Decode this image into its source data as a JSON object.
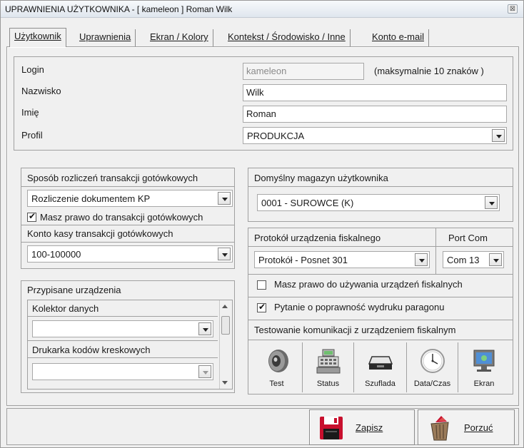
{
  "window": {
    "title": "UPRAWNIENIA UŻYTKOWNIKA - [ kameleon ] Roman Wilk",
    "close_glyph": "⊠"
  },
  "tabs": [
    {
      "label": "Użytkownik",
      "active": true
    },
    {
      "label": "Uprawnienia",
      "active": false
    },
    {
      "label": "Ekran / Kolory",
      "active": false
    },
    {
      "label": "Kontekst / Środowisko / Inne",
      "active": false
    },
    {
      "label": "Konto e-mail",
      "active": false
    }
  ],
  "user": {
    "login_label": "Login",
    "login_value": "kameleon",
    "login_hint": "(maksymalnie 10 znaków )",
    "surname_label": "Nazwisko",
    "surname_value": "Wilk",
    "name_label": "Imię",
    "name_value": "Roman",
    "profile_label": "Profil",
    "profile_value": "PRODUKCJA"
  },
  "cash": {
    "settlement_title": "Sposób rozliczeń transakcji gotówkowych",
    "settlement_value": "Rozliczenie dokumentem KP",
    "right_label": "Masz prawo do transakcji gotówkowych",
    "right_checked": true,
    "account_title": "Konto kasy transakcji gotówkowych",
    "account_value": "100-100000"
  },
  "devices": {
    "title": "Przypisane urządzenia",
    "collector_label": "Kolektor danych",
    "collector_value": "",
    "barcode_label": "Drukarka kodów kreskowych",
    "barcode_value": ""
  },
  "warehouse": {
    "title": "Domyślny magazyn użytkownika",
    "value": "0001 - SUROWCE (K)"
  },
  "fiscal": {
    "protocol_title": "Protokół urządzenia fiskalnego",
    "protocol_value": "Protokół - Posnet 301",
    "port_title": "Port Com",
    "port_value": "Com 13",
    "use_label": "Masz prawo do używania urządzeń fiskalnych",
    "use_checked": false,
    "ask_label": "Pytanie o poprawność wydruku paragonu",
    "ask_checked": true,
    "test_title": "Testowanie komunikacji z urządzeniem fiskalnym",
    "tools": [
      {
        "label": "Test",
        "icon": "speaker-icon"
      },
      {
        "label": "Status",
        "icon": "cash-register-icon"
      },
      {
        "label": "Szuflada",
        "icon": "drawer-icon"
      },
      {
        "label": "Data/Czas",
        "icon": "clock-icon"
      },
      {
        "label": "Ekran",
        "icon": "monitor-icon"
      }
    ]
  },
  "buttons": {
    "save_label": "Zapisz",
    "cancel_label": "Porzuć"
  }
}
